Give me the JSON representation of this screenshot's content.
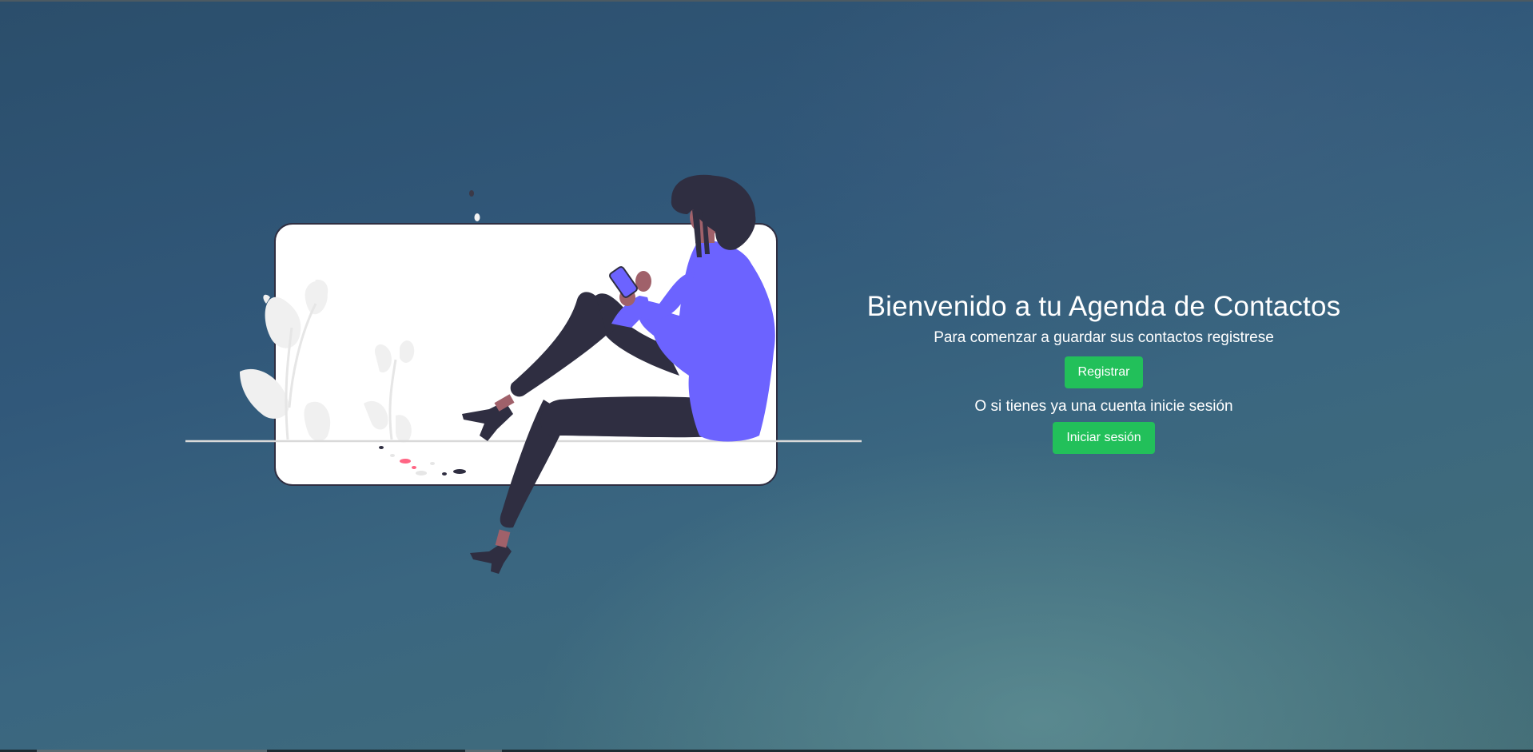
{
  "hero": {
    "title": "Bienvenido a tu Agenda de Contactos",
    "subtitle": "Para comenzar a guardar sus contactos registrese",
    "register_label": "Registrar",
    "login_prompt": "O si tienes ya una cuenta inicie sesión",
    "login_label": "Iniciar sesión"
  },
  "colors": {
    "button_green": "#22c05a",
    "accent_purple": "#6c63ff",
    "accent_pink": "#ff6584",
    "dark_figure": "#2f2e41",
    "card_white": "#ffffff"
  },
  "icons": {
    "illustration": "woman-with-phone-illustration"
  }
}
